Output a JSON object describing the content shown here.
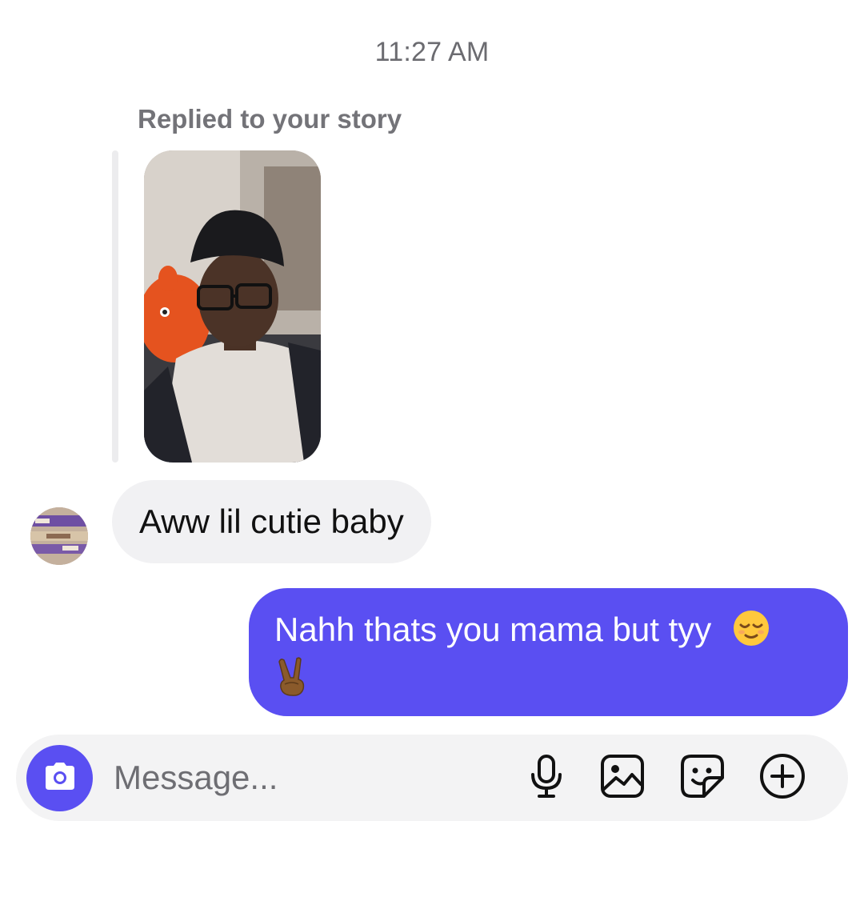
{
  "thread": {
    "timestamp": "11:27 AM",
    "reply_context_label": "Replied to your story"
  },
  "messages": [
    {
      "direction": "incoming",
      "text": "Aww lil cutie baby"
    },
    {
      "direction": "outgoing",
      "text_line1": "Nahh thats you mama but tyy",
      "emoji1": "relieved-face",
      "emoji2": "victory-hand-dark-skin"
    }
  ],
  "composer": {
    "placeholder": "Message...",
    "camera_icon": "camera-icon",
    "mic_icon": "microphone-icon",
    "gallery_icon": "gallery-icon",
    "sticker_icon": "sticker-icon",
    "add_icon": "plus-circle-icon"
  },
  "colors": {
    "accent": "#5a4ff2",
    "incoming_bubble": "#f1f1f3",
    "composer_bg": "#f3f3f4"
  }
}
